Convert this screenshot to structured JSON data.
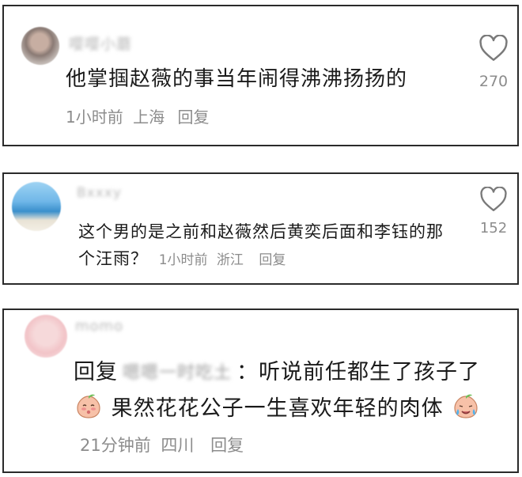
{
  "comments": [
    {
      "username": "嘤嘤小蘑",
      "avatar": "blurred-portrait-avatar",
      "content": "他掌掴赵薇的事当年闹得沸沸扬扬的",
      "time": "1小时前",
      "location": "上海",
      "reply_label": "回复",
      "likes": "270",
      "like_icon": "heart-outline-icon"
    },
    {
      "username": "Bxxxy",
      "avatar": "beach-scene-avatar",
      "content": "这个男的是之前和赵薇然后黄奕后面和李钰的那个汪雨？",
      "time": "1小时前",
      "location": "浙江",
      "reply_label": "回复",
      "likes": "152",
      "like_icon": "heart-outline-icon"
    },
    {
      "username": "momo",
      "avatar": "pink-blurred-avatar",
      "reply_prefix": "回复",
      "reply_target": "嗯嗯一时吃土",
      "content_part1": "：听说前任都生了孩子了",
      "emoji1": "shy-peach-emoji",
      "content_part2": "果然花花公子一生喜欢年轻的肉体",
      "emoji2": "crying-peach-emoji",
      "time": "21分钟前",
      "location": "四川",
      "reply_label": "回复"
    }
  ]
}
